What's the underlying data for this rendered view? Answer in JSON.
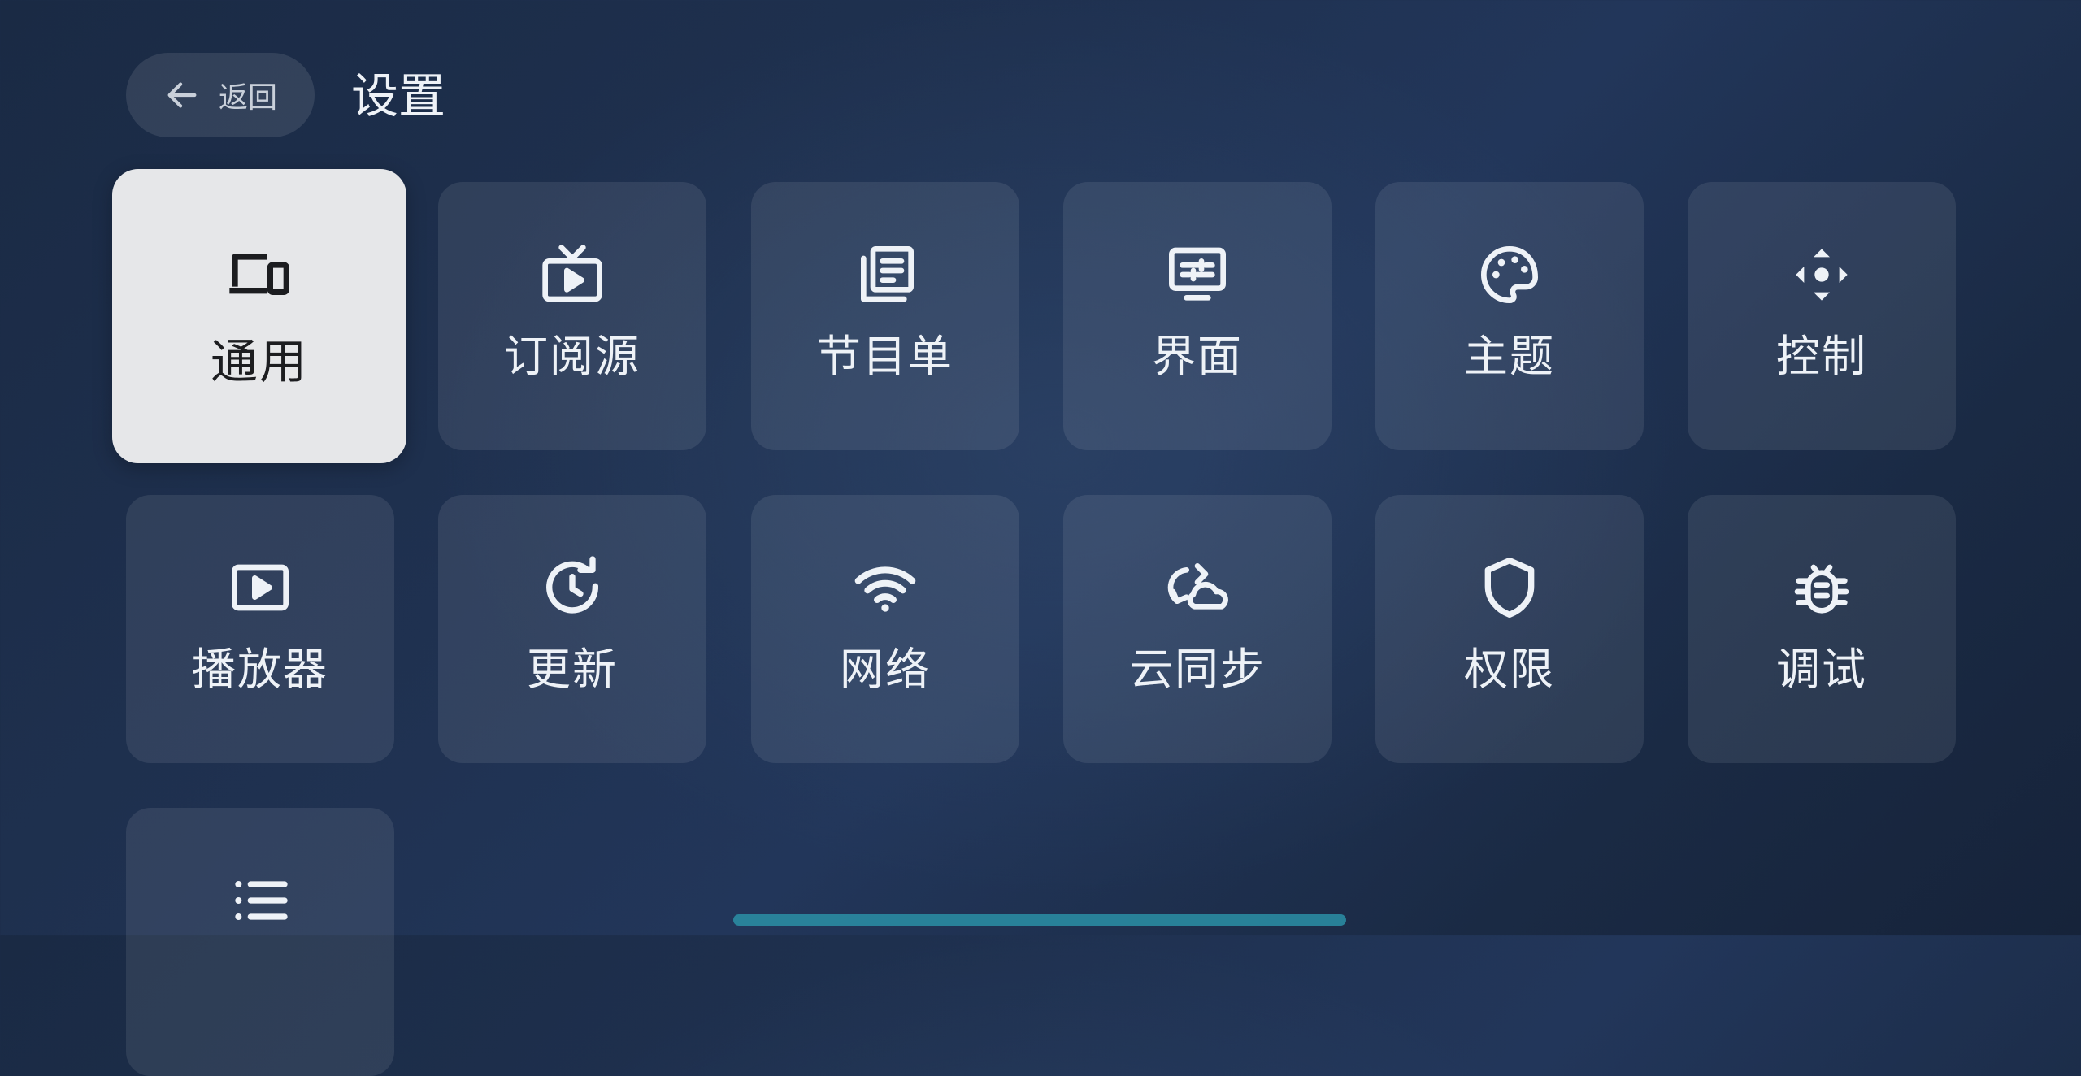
{
  "header": {
    "back_label": "返回",
    "title": "设置"
  },
  "tiles": [
    {
      "label": "通用",
      "icon": "devices-icon",
      "active": true
    },
    {
      "label": "订阅源",
      "icon": "tv-icon"
    },
    {
      "label": "节目单",
      "icon": "news-list-icon"
    },
    {
      "label": "界面",
      "icon": "display-settings-icon"
    },
    {
      "label": "主题",
      "icon": "palette-icon"
    },
    {
      "label": "控制",
      "icon": "dpad-icon"
    },
    {
      "label": "播放器",
      "icon": "play-box-icon"
    },
    {
      "label": "更新",
      "icon": "update-clock-icon"
    },
    {
      "label": "网络",
      "icon": "wifi-icon"
    },
    {
      "label": "云同步",
      "icon": "cloud-sync-icon"
    },
    {
      "label": "权限",
      "icon": "shield-icon"
    },
    {
      "label": "调试",
      "icon": "bug-icon"
    },
    {
      "label": "",
      "icon": "list-icon"
    }
  ],
  "colors": {
    "active_tile_bg": "#e6e7e9",
    "tile_bg": "rgba(255,255,255,0.085)",
    "scroll_indicator": "#2a8fa6"
  }
}
